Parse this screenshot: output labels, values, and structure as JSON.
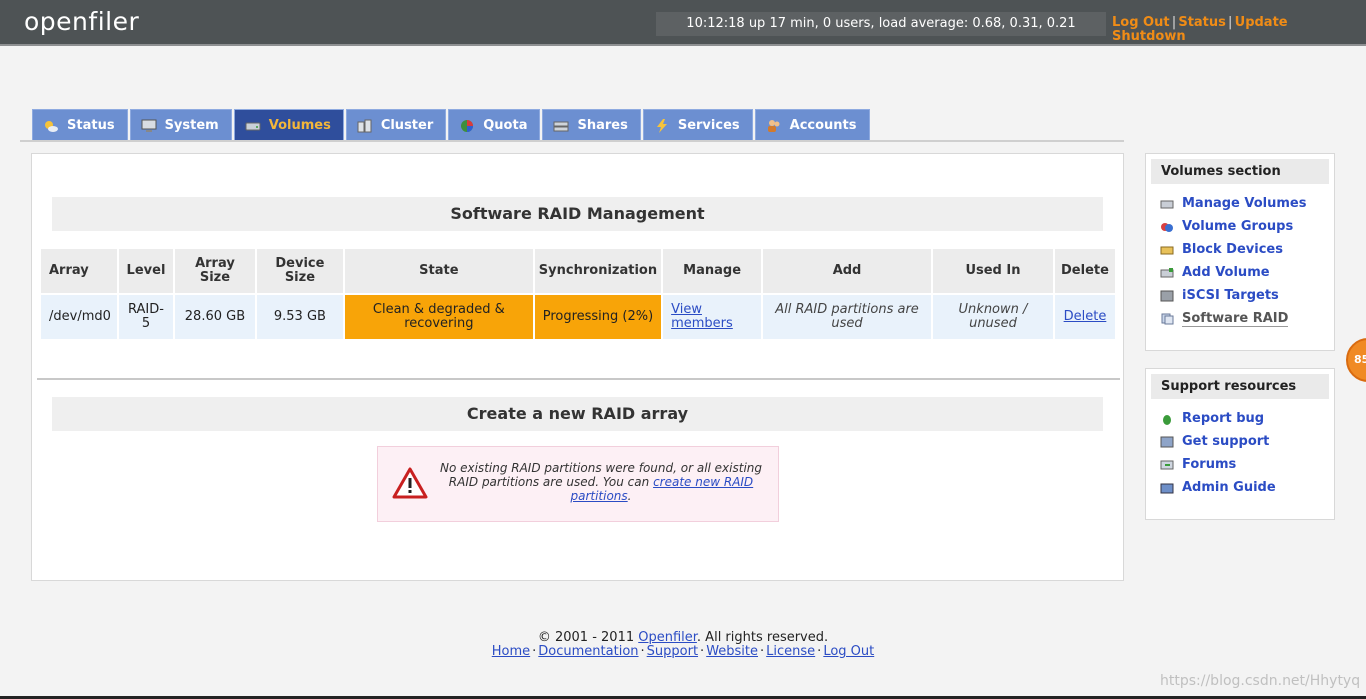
{
  "header": {
    "logo": "openfiler",
    "uptime": "10:12:18 up 17 min, 0 users, load average: 0.68, 0.31, 0.21",
    "links": {
      "logout": "Log Out",
      "status": "Status",
      "update": "Update",
      "shutdown": "Shutdown"
    }
  },
  "tabs": [
    {
      "label": "Status",
      "icon": "sun-cloud-icon"
    },
    {
      "label": "System",
      "icon": "monitor-icon"
    },
    {
      "label": "Volumes",
      "icon": "disk-icon",
      "active": true
    },
    {
      "label": "Cluster",
      "icon": "cluster-icon"
    },
    {
      "label": "Quota",
      "icon": "pie-icon"
    },
    {
      "label": "Shares",
      "icon": "drive-icon"
    },
    {
      "label": "Services",
      "icon": "lightning-icon"
    },
    {
      "label": "Accounts",
      "icon": "people-icon"
    }
  ],
  "raid": {
    "title": "Software RAID Management",
    "headers": {
      "array": "Array",
      "level": "Level",
      "array_size": "Array Size",
      "device_size": "Device Size",
      "state": "State",
      "sync": "Synchronization",
      "manage": "Manage",
      "add": "Add",
      "used_in": "Used In",
      "delete": "Delete"
    },
    "row": {
      "array": "/dev/md0",
      "level": "RAID-5",
      "array_size": "28.60 GB",
      "device_size": "9.53 GB",
      "state": "Clean & degraded & recovering",
      "sync": "Progressing (2%)",
      "manage": "View members",
      "add": "All RAID partitions are used",
      "used_in": "Unknown / unused",
      "delete": "Delete"
    }
  },
  "create": {
    "title": "Create a new RAID array",
    "message_pre": "No existing RAID partitions were found, or all existing RAID partitions are used. You can ",
    "message_link": "create new RAID partitions",
    "message_post": "."
  },
  "sidebar": {
    "volumes": {
      "title": "Volumes section",
      "items": [
        {
          "label": "Manage Volumes"
        },
        {
          "label": "Volume Groups"
        },
        {
          "label": "Block Devices"
        },
        {
          "label": "Add Volume"
        },
        {
          "label": "iSCSI Targets"
        },
        {
          "label": "Software RAID",
          "current": true
        }
      ]
    },
    "support": {
      "title": "Support resources",
      "items": [
        {
          "label": "Report bug"
        },
        {
          "label": "Get support"
        },
        {
          "label": "Forums"
        },
        {
          "label": "Admin Guide"
        }
      ]
    }
  },
  "badge": "85",
  "footer": {
    "copyright_pre": "© 2001 - 2011 ",
    "copyright_link": "Openfiler",
    "copyright_post": ". All rights reserved.",
    "links": [
      "Home",
      "Documentation",
      "Support",
      "Website",
      "License",
      "Log Out"
    ]
  },
  "watermark": "https://blog.csdn.net/Hhytyq",
  "colors": {
    "accent_orange": "#f08c16",
    "tab_blue": "#6c8fd1",
    "tab_active": "#2f4e9c",
    "state_orange": "#f8a408"
  }
}
